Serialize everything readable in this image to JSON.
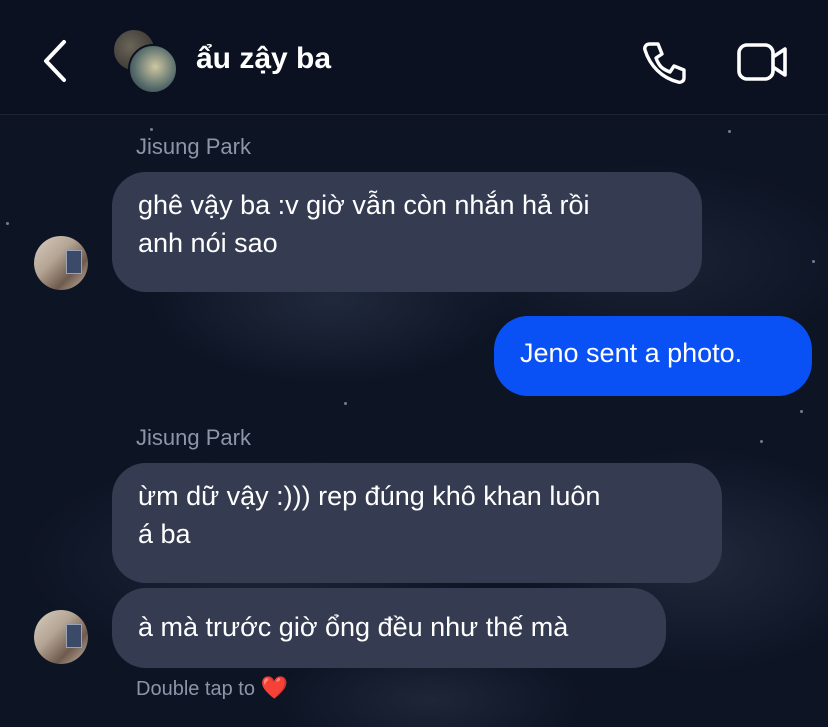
{
  "header": {
    "thread_name": "ẩu zậy ba",
    "icons": [
      "chevron-left-icon",
      "phone-icon",
      "video-camera-icon"
    ]
  },
  "messages": [
    {
      "sender": "Jisung Park",
      "lines": [
        "ghê vậy ba :v giờ vẫn còn nhắn hả rồi",
        "anh nói sao"
      ]
    },
    {
      "sender": "me",
      "text": "Jeno sent a photo."
    },
    {
      "sender": "Jisung Park",
      "lines": [
        "ừm dữ vậy :))) rep đúng khô khan luôn",
        "á ba"
      ]
    },
    {
      "sender": "Jisung Park",
      "lines": [
        "à mà trước giờ ổng đều như thế mà"
      ]
    }
  ],
  "hint": {
    "text": "Double tap to",
    "emoji": "❤️"
  },
  "colors": {
    "incoming_bubble": "#353c52",
    "outgoing_bubble": "#0a51f5",
    "heart": "#e7352f"
  }
}
